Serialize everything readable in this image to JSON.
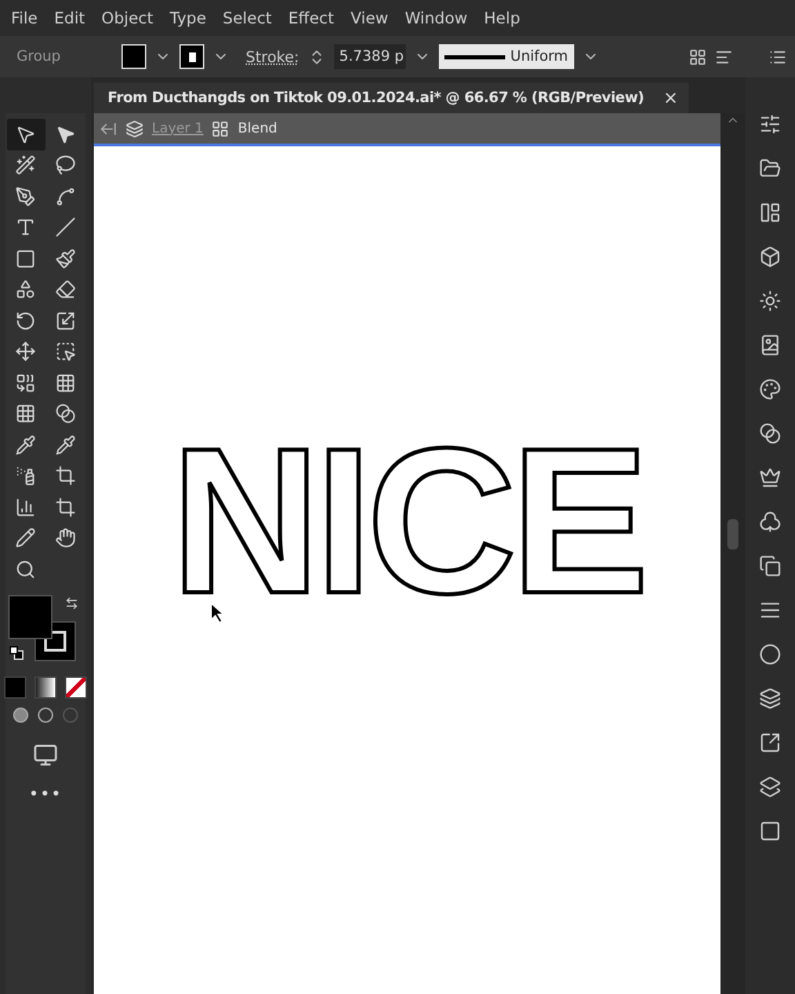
{
  "menu": [
    "File",
    "Edit",
    "Object",
    "Type",
    "Select",
    "Effect",
    "View",
    "Window",
    "Help"
  ],
  "control_bar": {
    "selection_label": "Group",
    "stroke_label": "Stroke:",
    "stroke_weight": "5.7389 p",
    "profile": "Uniform"
  },
  "document": {
    "tab_title": "From Ducthangds on Tiktok 09.01.2024.ai* @ 66.67 % (RGB/Preview)",
    "close": "×",
    "breadcrumb": [
      "Layer 1",
      "Blend"
    ],
    "artwork_text": "NICE"
  },
  "tools": [
    {
      "selected": true
    },
    {
      "selected": false
    },
    {
      "selected": false
    },
    {
      "selected": false
    },
    {
      "selected": false
    },
    {
      "selected": false
    },
    {
      "selected": false
    },
    {
      "selected": false
    },
    {
      "selected": false
    },
    {
      "selected": false
    },
    {
      "selected": false
    },
    {
      "selected": false
    },
    {
      "selected": false
    },
    {
      "selected": false
    },
    {
      "selected": false
    },
    {
      "selected": false
    },
    {
      "selected": false
    },
    {
      "selected": false
    },
    {
      "selected": false
    },
    {
      "selected": false
    },
    {
      "selected": false
    },
    {
      "selected": false
    },
    {
      "selected": false
    },
    {
      "selected": false
    },
    {
      "selected": false
    },
    {
      "selected": false
    },
    {
      "selected": false
    },
    {
      "selected": false
    },
    {
      "selected": false
    }
  ],
  "more_tools": "•••"
}
